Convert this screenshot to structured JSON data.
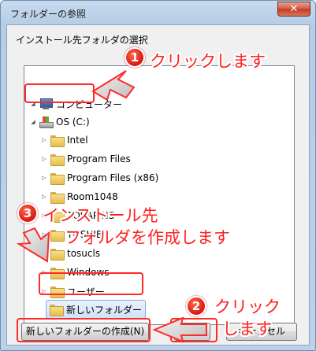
{
  "window": {
    "title": "フォルダーの参照",
    "close_glyph": "✕"
  },
  "instruction": "インストール先フォルダの選択",
  "tree": {
    "computer": {
      "label": "コンピューター",
      "expander": "◢"
    },
    "drive": {
      "label": "OS (C:)",
      "expander": "◢"
    },
    "folders": [
      {
        "label": "Intel",
        "expander": "▷"
      },
      {
        "label": "Program Files",
        "expander": "▷"
      },
      {
        "label": "Program Files (x86)",
        "expander": "▷"
      },
      {
        "label": "Room1048",
        "expander": "▷"
      },
      {
        "label": "TOSAPINS",
        "expander": "▷"
      },
      {
        "label": "TOSHIBA",
        "expander": "▷"
      },
      {
        "label": "tosucls",
        "expander": "▷"
      },
      {
        "label": "Windows",
        "expander": "▷"
      },
      {
        "label": "ユーザー",
        "expander": "▷"
      }
    ],
    "new_folder": {
      "label": "新しいフォルダー"
    }
  },
  "buttons": {
    "new_folder": "新しいフォルダーの作成(N)",
    "ok": "OK",
    "cancel": "キャンセル"
  },
  "annotations": {
    "step1": {
      "number": "1",
      "text": "クリックします"
    },
    "step2": {
      "number": "2",
      "text_line1": "クリック",
      "text_line2": "します"
    },
    "step3": {
      "number": "3",
      "text_line1": "インストール先",
      "text_line2": "フォルダを作成します"
    }
  },
  "colors": {
    "annotation_red": "#ff2020",
    "selection_border": "#84acdd"
  }
}
